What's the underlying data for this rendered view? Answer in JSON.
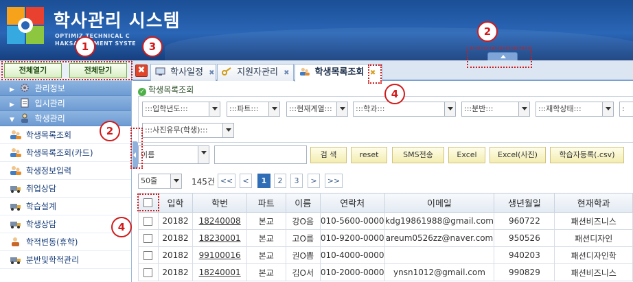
{
  "header": {
    "title": "학사관리 시스템",
    "sub_line1": "OPTIMIZ      TECHNICAL C",
    "sub_line2": "HAKSA       AGEMENT SYSTE"
  },
  "sidebar": {
    "expand_all": "전체열기",
    "collapse_all": "전체닫기",
    "categories": [
      {
        "label": "관리정보",
        "arrow": "▶"
      },
      {
        "label": "입시관리",
        "arrow": "▶"
      },
      {
        "label": "학생관리",
        "arrow": "▼"
      }
    ],
    "items": [
      {
        "label": "학생목록조회"
      },
      {
        "label": "학생목록조회(카드)"
      },
      {
        "label": "학생정보입력"
      },
      {
        "label": "취업상담"
      },
      {
        "label": "학습설계"
      },
      {
        "label": "학생상담"
      },
      {
        "label": "학적변동(휴학)"
      },
      {
        "label": "분반및학적관리"
      }
    ]
  },
  "tabs": [
    {
      "label": "학사일정",
      "close": "✖"
    },
    {
      "label": "지원자관리",
      "close": "✖"
    },
    {
      "label": "학생목록조회",
      "close": "✖"
    }
  ],
  "close_all_glyph": "✖",
  "breadcrumb": "학생목록조회",
  "filters": {
    "row1": [
      ":::입학년도:::",
      ":::파트:::",
      ":::현재계열:::",
      ":::학과:::",
      ":::분반:::",
      ":::재학상태:::",
      ":"
    ],
    "photo": ":::사진유무(학생):::",
    "search_field": "이름",
    "search_value": ""
  },
  "buttons": {
    "search": "검 색",
    "reset": "reset",
    "sms": "SMS전송",
    "excel": "Excel",
    "excel_photo": "Excel(사진)",
    "register": "학습자등록(.csv)"
  },
  "pager": {
    "page_size": "50줄",
    "total": "145건",
    "first": "<<",
    "prev": "<",
    "pages": [
      "1",
      "2",
      "3"
    ],
    "next": ">",
    "last": ">>"
  },
  "table": {
    "headers": [
      "입학",
      "학번",
      "파트",
      "이름",
      "연락처",
      "이메일",
      "생년월일",
      "현재학과"
    ],
    "rows": [
      [
        "20182",
        "18240008",
        "본교",
        "강O음",
        "010-5600-0000",
        "kdg19861988@gmail.com",
        "960722",
        "패션비즈니스"
      ],
      [
        "20182",
        "18230001",
        "본교",
        "고O름",
        "010-9200-0000",
        "areum0526zz@naver.com",
        "950526",
        "패션디자인"
      ],
      [
        "20182",
        "99100016",
        "본교",
        "권O쁨",
        "010-4000-0000",
        "",
        "940203",
        "패션디자인학"
      ],
      [
        "20182",
        "18240001",
        "본교",
        "김O서",
        "010-2000-0000",
        "ynsn1012@gmail.com",
        "990829",
        "패션비즈니스"
      ]
    ]
  },
  "annotations": [
    "1",
    "2",
    "3",
    "2",
    "4",
    "4"
  ],
  "colors": {
    "header_bg": "#1b4f96",
    "accent": "#2f6db6",
    "annotation": "#d21a1a"
  }
}
